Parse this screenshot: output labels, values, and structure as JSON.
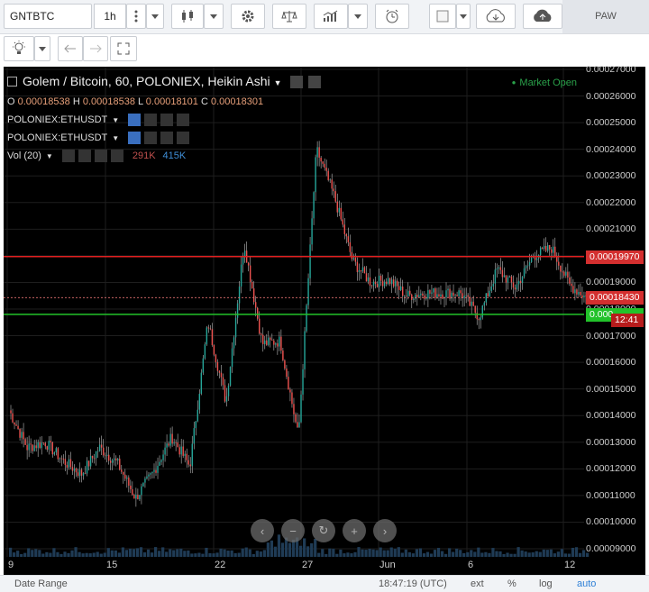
{
  "toolbar": {
    "symbol": "GNTBTC",
    "interval": "1h",
    "account": "PAW"
  },
  "chart": {
    "title": "Golem / Bitcoin, 60, POLONIEX, Heikin Ashi",
    "ohlc": {
      "o_label": "O",
      "o": "0.00018538",
      "h_label": "H",
      "h": "0.00018538",
      "l_label": "L",
      "l": "0.00018101",
      "c_label": "C",
      "c": "0.00018301"
    },
    "indicators": [
      {
        "label": "POLONIEX:ETHUSDT"
      },
      {
        "label": "POLONIEX:ETHUSDT"
      }
    ],
    "volume": {
      "label": "Vol (20)",
      "v1": "291K",
      "v2": "415K"
    },
    "market_status": "Market Open",
    "price_tags": {
      "red_line": "0.00019970",
      "current": "0.00018430",
      "green_line": "0.000",
      "countdown": "12:41"
    },
    "colors": {
      "up": "#26a69a",
      "down": "#ef5350",
      "red_line": "#e02020",
      "green_line": "#22c22a",
      "current_tag": "#d32f2f"
    }
  },
  "price_axis": [
    "0.00027000",
    "0.00026000",
    "0.00025000",
    "0.00024000",
    "0.00023000",
    "0.00022000",
    "0.00021000",
    "0.00020000",
    "0.00019000",
    "0.00018000",
    "0.00017000",
    "0.00016000",
    "0.00015000",
    "0.00014000",
    "0.00013000",
    "0.00012000",
    "0.00011000",
    "0.00010000",
    "0.00009000"
  ],
  "time_axis": [
    {
      "label": "9"
    },
    {
      "label": "15"
    },
    {
      "label": "22"
    },
    {
      "label": "27"
    },
    {
      "label": "Jun"
    },
    {
      "label": "6"
    },
    {
      "label": "12"
    }
  ],
  "bottom_bar": {
    "date_range": "Date Range",
    "time": "18:47:19 (UTC)",
    "ext": "ext",
    "percent": "%",
    "log": "log",
    "auto": "auto"
  },
  "chart_data": {
    "type": "candlestick",
    "title": "Golem / Bitcoin, 60, POLONIEX, Heikin Ashi",
    "ylim": [
      9e-05,
      0.00027
    ],
    "x": [
      "9",
      "15",
      "22",
      "27",
      "Jun",
      "6",
      "12"
    ],
    "close_path": [
      0.000142,
      0.000128,
      0.00013,
      0.000123,
      0.000118,
      0.000128,
      0.000122,
      0.000109,
      0.000119,
      0.000132,
      0.000121,
      0.000175,
      0.000145,
      0.000205,
      0.000167,
      0.000168,
      0.000132,
      0.00024,
      0.000222,
      0.000198,
      0.00019,
      0.000191,
      0.000185,
      0.000186,
      0.000186,
      0.000186,
      0.000177,
      0.000195,
      0.000188,
      0.0002,
      0.000203,
      0.000189,
      0.000184
    ],
    "horizontal_lines": [
      0.0001997,
      0.000178
    ],
    "last_price": 0.0001843
  }
}
